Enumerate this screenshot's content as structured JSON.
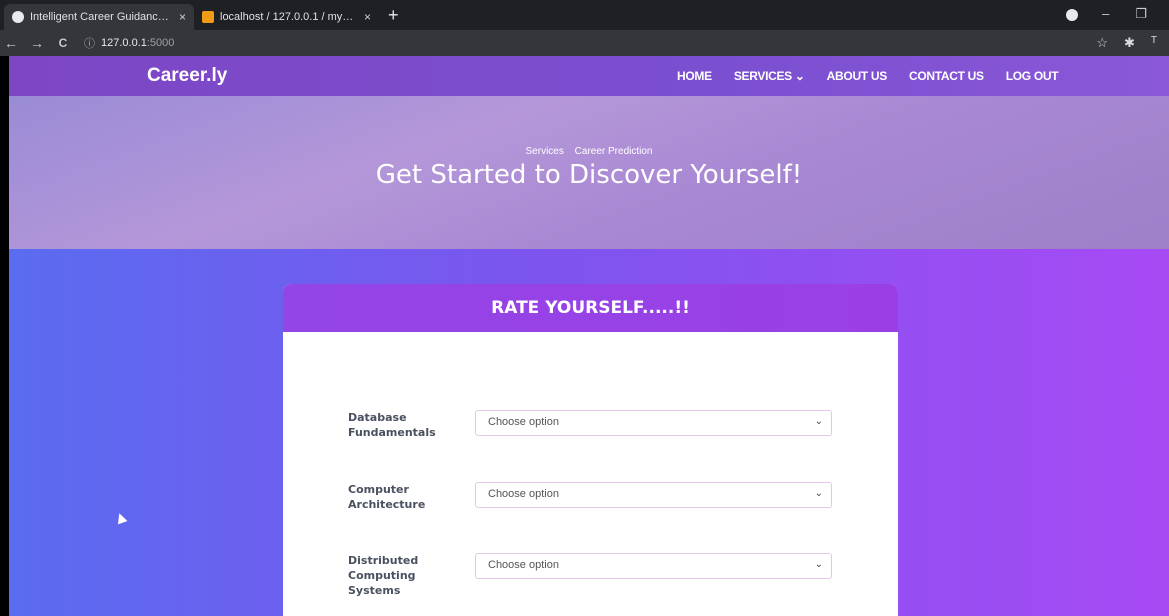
{
  "browser": {
    "tabs": [
      {
        "title": "Intelligent Career Guidance Syst",
        "close": "×",
        "active": true,
        "favicon_color": "#e8eaed"
      },
      {
        "title": "localhost / 127.0.0.1 / my_db / u",
        "close": "×",
        "active": false,
        "favicon_color": "#f29b16"
      }
    ],
    "new_tab": "+",
    "url": {
      "host": "127.0.0.1",
      "port": ":5000"
    },
    "window_controls": {
      "minimize": "–",
      "restore": "❐"
    },
    "nav": {
      "back": "←",
      "forward": "→",
      "reload": "C",
      "info": "ⓘ"
    },
    "extensions": {
      "star": "☆",
      "puzzle": "✱",
      "profile": "T"
    }
  },
  "navbar": {
    "brand": "Career.ly",
    "menu": [
      "HOME",
      "SERVICES ⌄",
      "ABOUT US",
      "CONTACT US",
      "LOG OUT"
    ]
  },
  "hero": {
    "breadcrumbs": [
      "Services",
      "Career Prediction"
    ],
    "title": "Get Started to Discover Yourself!"
  },
  "form": {
    "header": "RATE YOURSELF.....!!",
    "fields": [
      {
        "label": "Database Fundamentals",
        "value": "Choose option"
      },
      {
        "label": "Computer Architecture",
        "value": "Choose option"
      },
      {
        "label": "Distributed Computing Systems",
        "value": "Choose option"
      }
    ],
    "chevron": "⌄"
  }
}
